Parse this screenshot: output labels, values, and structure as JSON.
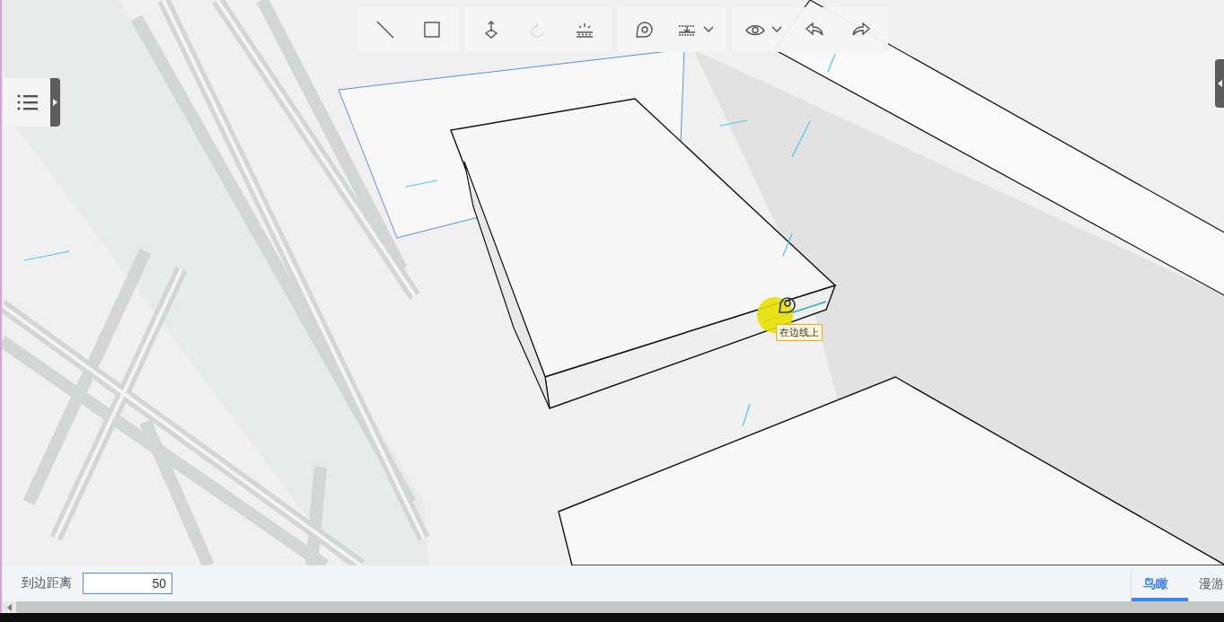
{
  "toolbar": {
    "groups": [
      {
        "tools": [
          {
            "kind": "line",
            "disabled": false,
            "dropdown": false
          },
          {
            "kind": "rectangle",
            "disabled": false,
            "dropdown": false
          }
        ]
      },
      {
        "tools": [
          {
            "kind": "push-pull",
            "disabled": false,
            "dropdown": false
          },
          {
            "kind": "rotate",
            "disabled": true,
            "dropdown": false
          },
          {
            "kind": "light",
            "disabled": false,
            "dropdown": false
          }
        ]
      },
      {
        "tools": [
          {
            "kind": "tape",
            "disabled": false,
            "dropdown": false
          },
          {
            "kind": "section",
            "disabled": false,
            "dropdown": true
          }
        ]
      },
      {
        "tools": [
          {
            "kind": "view",
            "disabled": false,
            "dropdown": true
          },
          {
            "kind": "undo",
            "disabled": false,
            "dropdown": false
          },
          {
            "kind": "redo",
            "disabled": false,
            "dropdown": false
          }
        ]
      }
    ]
  },
  "snap_tooltip": "在边线上",
  "bottom_bar": {
    "label": "到边距离",
    "input": {
      "value": "50"
    },
    "tabs": [
      {
        "label": "鸟瞰",
        "selected": true
      },
      {
        "label": "漫游",
        "selected": false
      }
    ]
  }
}
